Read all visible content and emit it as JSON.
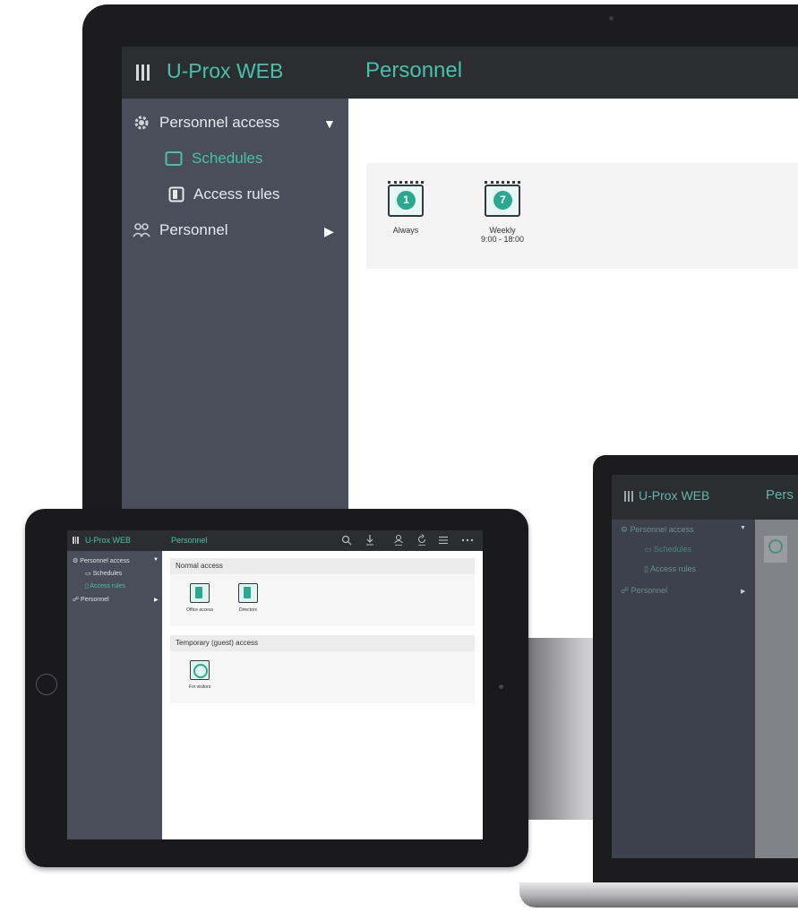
{
  "app": {
    "brand": "U-Prox WEB",
    "page_title": "Personnel",
    "accent_color": "#45c2a9"
  },
  "monitor": {
    "sidebar": {
      "items": [
        {
          "label": "Personnel access",
          "icon": "gear-icon",
          "caret": "▼"
        },
        {
          "label": "Schedules",
          "icon": "calendar-icon",
          "active": true
        },
        {
          "label": "Access rules",
          "icon": "door-icon"
        },
        {
          "label": "Personnel",
          "icon": "people-icon",
          "caret": "▶"
        }
      ]
    },
    "schedules": [
      {
        "badge": "1",
        "caption": "Always",
        "caption2": ""
      },
      {
        "badge": "7",
        "caption": "Weekly",
        "caption2": "9:00 - 18:00"
      }
    ]
  },
  "tablet": {
    "brand": "U-Prox WEB",
    "page_title": "Personnel",
    "sidebar": {
      "items": [
        {
          "label": "Personnel access",
          "caret": "▼"
        },
        {
          "label": "Schedules"
        },
        {
          "label": "Access rules",
          "active": true
        },
        {
          "label": "Personnel",
          "caret": "▶"
        }
      ]
    },
    "sections": [
      {
        "title": "Normal access",
        "tiles": [
          {
            "caption": "Office access"
          },
          {
            "caption": "Directors"
          }
        ]
      },
      {
        "title": "Temporary (guest) access",
        "tiles": [
          {
            "caption": "For visitors"
          }
        ]
      }
    ]
  },
  "laptop": {
    "brand": "U-Prox WEB",
    "page_title_partial": "Pers",
    "sidebar": {
      "items": [
        {
          "label": "Personnel access",
          "caret": "▼"
        },
        {
          "label": "Schedules"
        },
        {
          "label": "Access rules"
        },
        {
          "label": "Personnel",
          "caret": "▶"
        }
      ]
    }
  }
}
